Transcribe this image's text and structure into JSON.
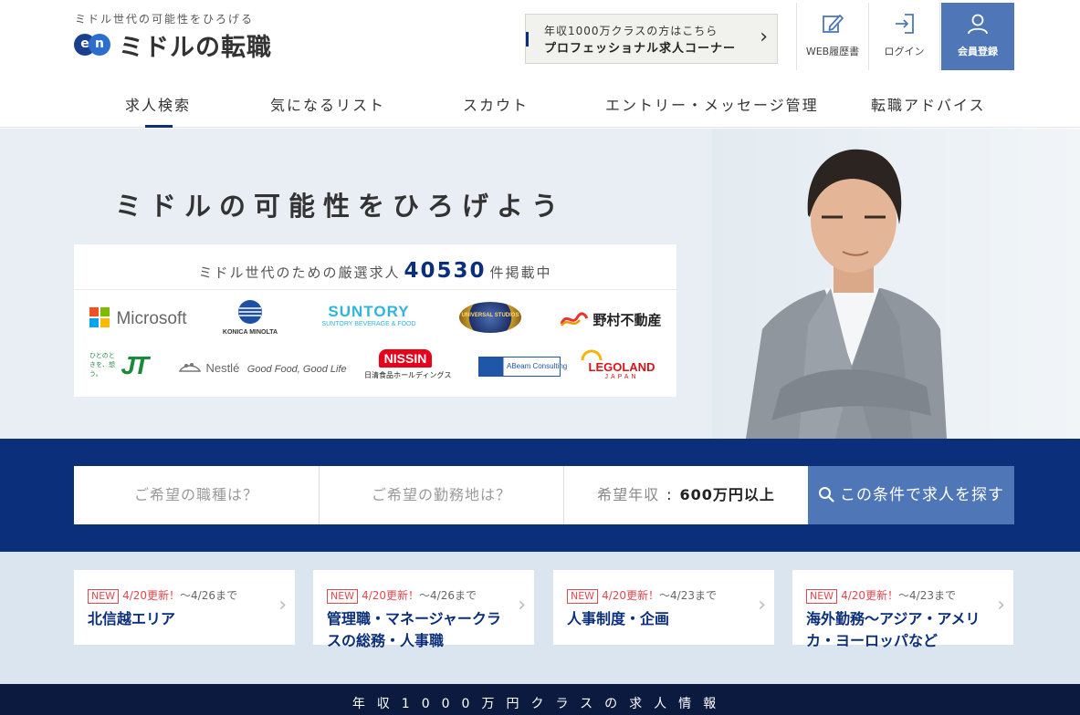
{
  "header": {
    "tagline": "ミドル世代の可能性をひろげる",
    "logo_mark": "en",
    "logo_text": "ミドルの転職",
    "pro_banner": {
      "line1": "年収1000万クラスの方はこちら",
      "line2": "プロフェッショナル求人コーナー"
    },
    "buttons": {
      "resume": "WEB履歴書",
      "login": "ログイン",
      "register": "会員登録"
    }
  },
  "nav": {
    "items": [
      "求人検索",
      "気になるリスト",
      "スカウト",
      "エントリー・メッセージ管理",
      "転職アドバイス"
    ],
    "active": "求人検索"
  },
  "hero": {
    "title": "ミドルの可能性をひろげよう",
    "count_prefix": "ミドル世代のための厳選求人",
    "count": "40530",
    "count_suffix": "件掲載中",
    "logos": {
      "microsoft": "Microsoft",
      "konica": "KONICA MINOLTA",
      "suntory": "SUNTORY",
      "suntory_sub": "SUNTORY BEVERAGE & FOOD",
      "universal": "UNIVERSAL STUDIOS",
      "nomura": "野村不動産",
      "jt": "JT",
      "jt_side": "ひとのときを、想う。",
      "nestle": "Nestlé",
      "nestle_tag": "Good Food, Good Life",
      "nissin": "NISSIN",
      "nissin_sub": "日清食品ホールディングス",
      "abeam": "ABeam Consulting",
      "legoland": "LEGOLAND",
      "legoland_sub": "JAPAN"
    }
  },
  "search": {
    "job_placeholder": "ご希望の職種は？",
    "location_placeholder": "ご希望の勤務地は？",
    "salary_label": "希望年収",
    "salary_value": "600万円以上",
    "button": "この条件で求人を探す"
  },
  "features": [
    {
      "badge": "NEW",
      "updated": "4/20更新！",
      "period": "〜4/26まで",
      "title": "北信越エリア"
    },
    {
      "badge": "NEW",
      "updated": "4/20更新！",
      "period": "〜4/26まで",
      "title": "管理職・マネージャークラスの総務・人事職"
    },
    {
      "badge": "NEW",
      "updated": "4/20更新！",
      "period": "〜4/23まで",
      "title": "人事制度・企画"
    },
    {
      "badge": "NEW",
      "updated": "4/20更新！",
      "period": "〜4/23まで",
      "title": "海外勤務〜アジア・アメリカ・ヨーロッパなど"
    }
  ],
  "bottom_banner": "年収1000万円クラスの求人情報",
  "colors": {
    "navy": "#0b2f7a",
    "accent_blue": "#4f77b7",
    "new_red": "#e0484f"
  }
}
